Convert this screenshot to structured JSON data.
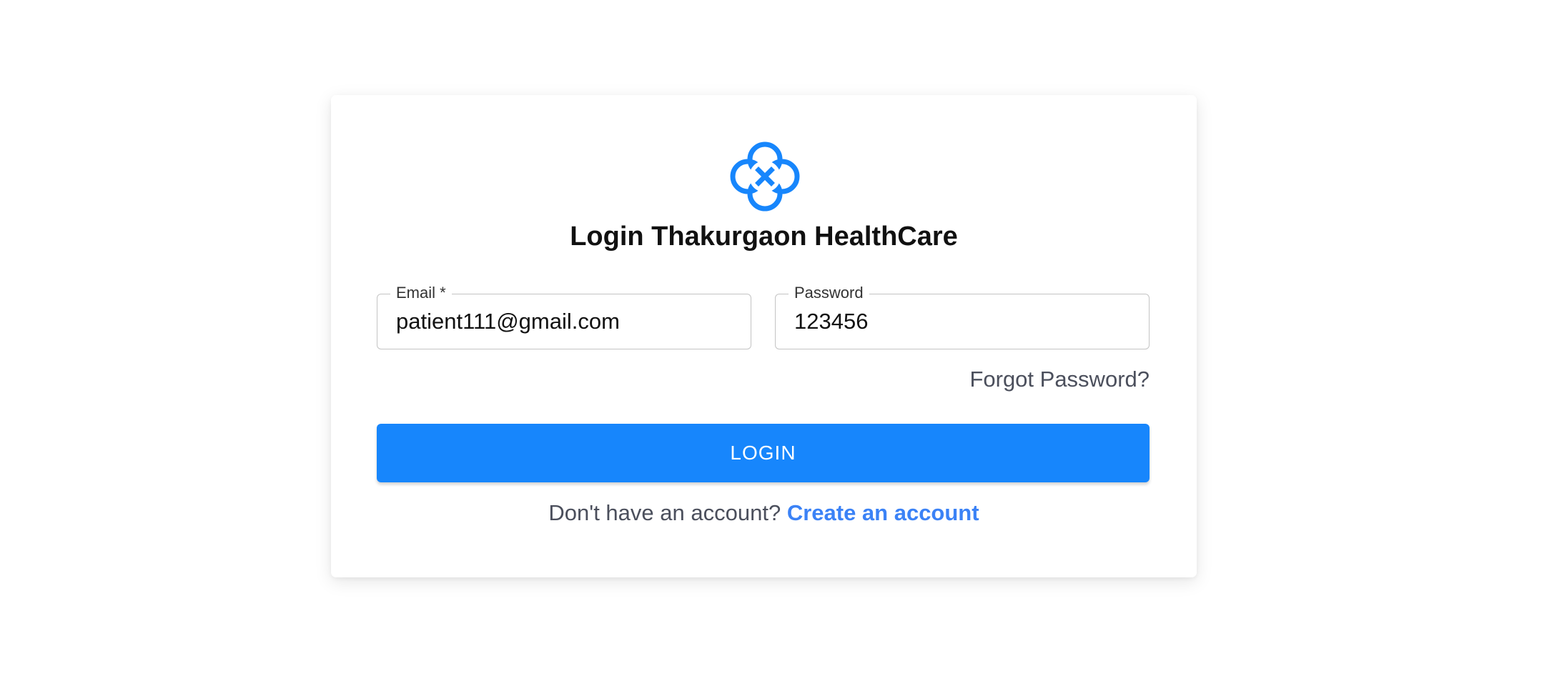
{
  "app": {
    "title": "Login Thakurgaon HealthCare",
    "logo_icon": "clover-cross-icon",
    "accent_color": "#1786fc"
  },
  "form": {
    "email": {
      "label": "Email",
      "required_marker": " *",
      "value": "patient111@gmail.com"
    },
    "password": {
      "label": "Password",
      "value": "123456"
    },
    "forgot_label": "Forgot Password?",
    "login_label": "LOGIN"
  },
  "signup": {
    "prompt": "Don't have an account?",
    "link_label": "Create an account"
  }
}
